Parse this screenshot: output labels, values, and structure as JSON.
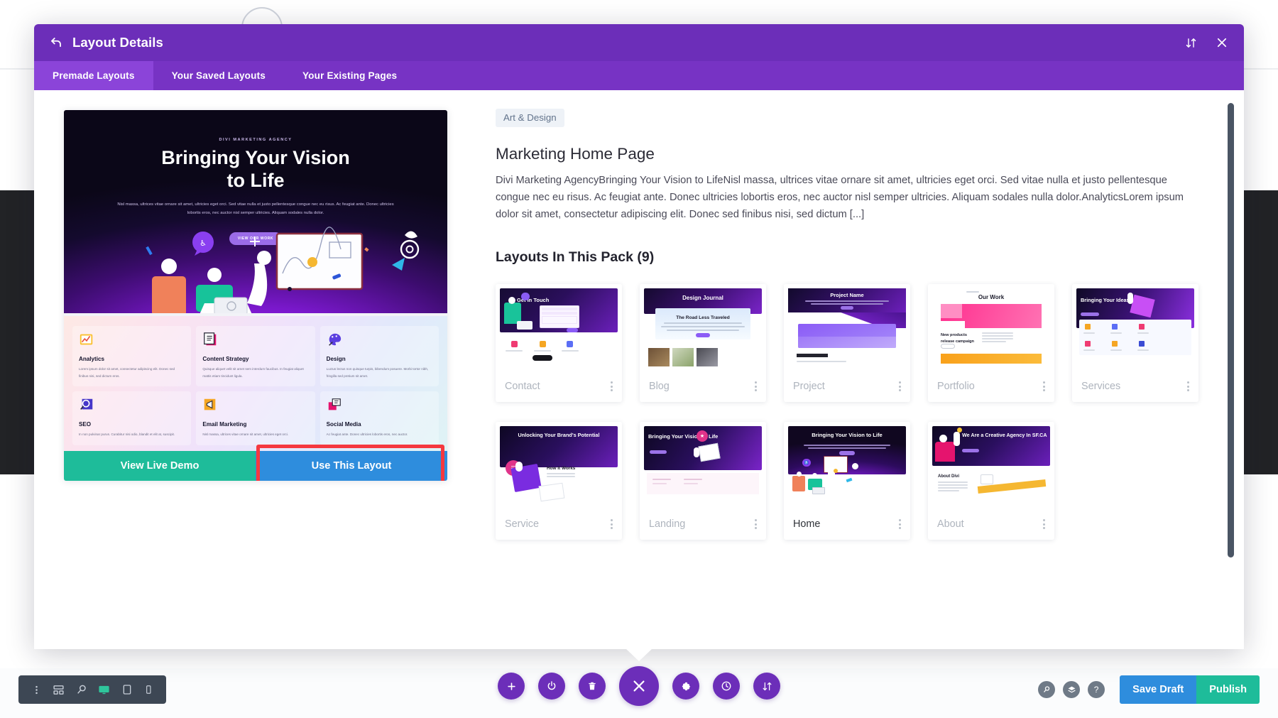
{
  "modal": {
    "header": {
      "title": "Layout Details",
      "back_icon": "back-arrow-icon",
      "sort_icon": "sort-updown-icon",
      "close_icon": "close-icon"
    },
    "tabs": [
      {
        "label": "Premade Layouts",
        "active": true
      },
      {
        "label": "Your Saved Layouts",
        "active": false
      },
      {
        "label": "Your Existing Pages",
        "active": false
      }
    ]
  },
  "preview": {
    "hero": {
      "eyebrow": "DIVI MARKETING AGENCY",
      "title_line1": "Bringing Your Vision",
      "title_line2": "to Life",
      "lede": "Nisl massa, ultrices vitae ornare sit amet, ultricies eget orci. Sed vitae nulla et justo pellentesque congue nec eu risus. Ac feugiat ante. Donec ultricies lobortis eros, nec auctor nisl semper ultricies. Aliquam sodales nulla dolor.",
      "cta": "VIEW OUR WORK"
    },
    "features": [
      {
        "title": "Analytics",
        "body": "Lorem ipsum dolor sit amet, consectetur adipiscing elit. Donec sed finibus nisi, sed dictum eros.",
        "icon": "chart-icon"
      },
      {
        "title": "Content Strategy",
        "body": "Quisque aliquet velit sit amet sem interdum faucibus. In feugiat aliquet mattis etiam tincidunt ligula.",
        "icon": "document-icon"
      },
      {
        "title": "Design",
        "body": "Luctus lectus non quisque turpis, bibendum posuere. Morbi tortor nibh, fringilla sed pretium sit amet.",
        "icon": "palette-icon"
      },
      {
        "title": "SEO",
        "body": "In non pulvinar purus. Curabitur nisi odio, blandit et elit at, suscipit.",
        "icon": "magnifier-icon"
      },
      {
        "title": "Email Marketing",
        "body": "Nisl massa, ultrices vitae ornare sit amet, ultricies eget orci.",
        "icon": "megaphone-icon"
      },
      {
        "title": "Social Media",
        "body": "Ac feugiat ante. Donec ultricies lobortis eros, nec auctor.",
        "icon": "chat-icon"
      }
    ],
    "actions": {
      "demo_label": "View Live Demo",
      "use_label": "Use This Layout",
      "highlight_color": "#f5383f",
      "demo_color": "#1ebc9a",
      "use_color": "#2e8ddd"
    }
  },
  "detail": {
    "category": "Art & Design",
    "title": "Marketing Home Page",
    "description": "Divi Marketing AgencyBringing Your Vision to LifeNisl massa, ultrices vitae ornare sit amet, ultricies eget orci. Sed vitae nulla et justo pellentesque congue nec eu risus. Ac feugiat ante. Donec ultricies lobortis eros, nec auctor nisl semper ultricies. Aliquam sodales nulla dolor.AnalyticsLorem ipsum dolor sit amet, consectetur adipiscing elit. Donec sed finibus nisi, sed dictum [...]",
    "pack_heading": "Layouts In This Pack (9)",
    "layouts": [
      {
        "name": "Contact",
        "active": false,
        "thumb_title": "Get In Touch"
      },
      {
        "name": "Blog",
        "active": false,
        "thumb_title": "Design Journal"
      },
      {
        "name": "Project",
        "active": false,
        "thumb_title": "Project Name"
      },
      {
        "name": "Portfolio",
        "active": false,
        "thumb_title": "Our Work"
      },
      {
        "name": "Services",
        "active": false,
        "thumb_title": "Bringing Your Ideas to Life"
      },
      {
        "name": "Service",
        "active": false,
        "thumb_title": "Unlocking Your Brand's Potential"
      },
      {
        "name": "Landing",
        "active": false,
        "thumb_title": "Bringing Your Vision to Life"
      },
      {
        "name": "Home",
        "active": true,
        "thumb_title": "Bringing Your Vision to Life"
      },
      {
        "name": "About",
        "active": false,
        "thumb_title": "We Are a Creative Agency In SF.CA"
      }
    ],
    "thumb_sub": {
      "blog": "The Road Less Traveled",
      "portfolio": "New products release campaign",
      "about": "About Divi",
      "service": "How It Works"
    }
  },
  "toolbars": {
    "left": [
      {
        "icon": "kebab-menu-icon",
        "active": false
      },
      {
        "icon": "wireframe-icon",
        "active": false
      },
      {
        "icon": "zoom-icon",
        "active": false
      },
      {
        "icon": "desktop-icon",
        "active": true
      },
      {
        "icon": "tablet-icon",
        "active": false
      },
      {
        "icon": "phone-icon",
        "active": false
      }
    ],
    "center": [
      {
        "icon": "plus-icon",
        "big": false
      },
      {
        "icon": "power-icon",
        "big": false
      },
      {
        "icon": "trash-icon",
        "big": false
      },
      {
        "icon": "close-icon",
        "big": true
      },
      {
        "icon": "gear-icon",
        "big": false
      },
      {
        "icon": "history-clock-icon",
        "big": false
      },
      {
        "icon": "sort-updown-icon",
        "big": false
      }
    ],
    "right_icons": [
      {
        "icon": "search-icon"
      },
      {
        "icon": "layers-icon"
      },
      {
        "icon": "help-icon"
      }
    ],
    "save_draft_label": "Save Draft",
    "publish_label": "Publish"
  },
  "colors": {
    "modal_header": "#6c2eb9",
    "tabbar": "#7733c4",
    "tab_active": "#8b44d9",
    "accent_green": "#1ebc9a",
    "accent_blue": "#2e8ddd",
    "highlight_red": "#f5383f",
    "dark_toolbar": "#3d4754"
  }
}
